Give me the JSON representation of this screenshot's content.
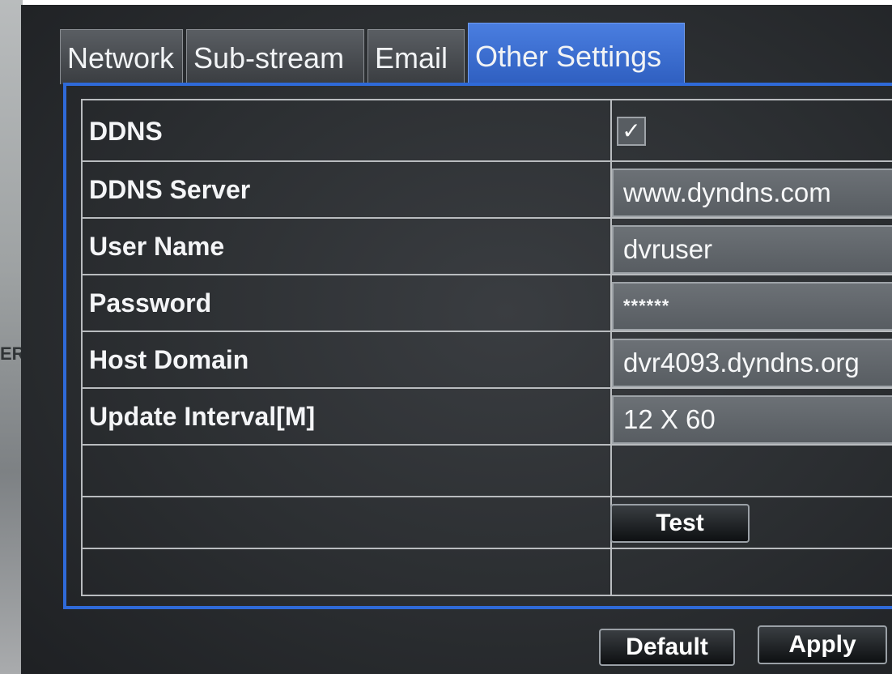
{
  "tabs": [
    {
      "label": "Network",
      "active": false
    },
    {
      "label": "Sub-stream",
      "active": false
    },
    {
      "label": "Email",
      "active": false
    },
    {
      "label": "Other Settings",
      "active": true
    }
  ],
  "ddns": {
    "label": "DDNS",
    "enabled": true,
    "check_glyph": "✓"
  },
  "fields": {
    "ddns_server": {
      "label": "DDNS Server",
      "value": "www.dyndns.com"
    },
    "user_name": {
      "label": "User Name",
      "value": "dvruser"
    },
    "password": {
      "label": "Password",
      "value": "******"
    },
    "host_domain": {
      "label": "Host Domain",
      "value": "dvr4093.dyndns.org"
    },
    "update_interval": {
      "label": "Update Interval[M]",
      "value": "12 X 60"
    }
  },
  "buttons": {
    "test": "Test",
    "default": "Default",
    "apply": "Apply"
  },
  "colors": {
    "active_tab": "#3a6fd8",
    "panel_border": "#2f6ad8",
    "screen_background": "#2e3134"
  }
}
